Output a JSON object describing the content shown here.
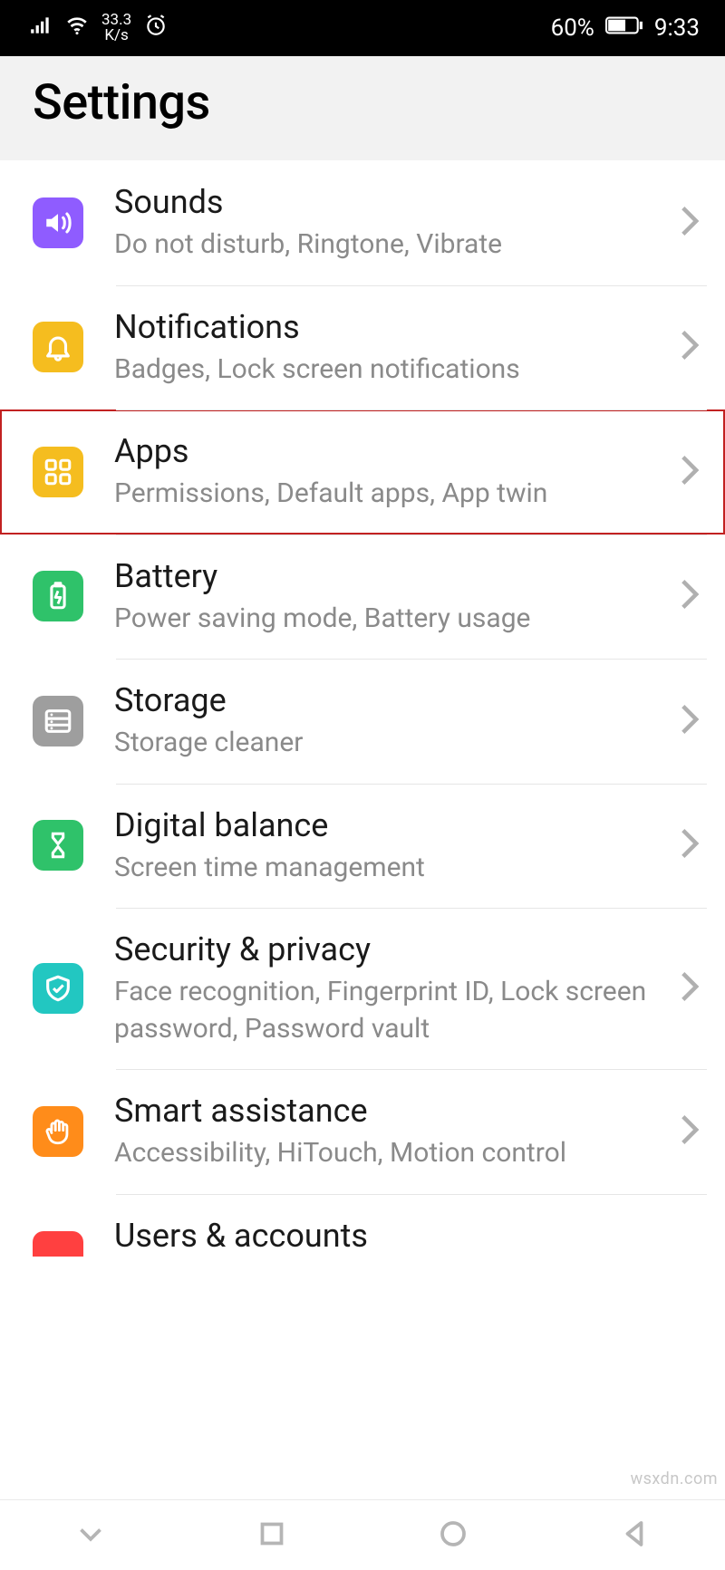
{
  "status_bar": {
    "net_speed_top": "33.3",
    "net_speed_bottom": "K/s",
    "battery_percent": "60%",
    "time": "9:33"
  },
  "header": {
    "title": "Settings"
  },
  "items": {
    "sounds": {
      "title": "Sounds",
      "subtitle": "Do not disturb, Ringtone, Vibrate",
      "color": "#8f5cff"
    },
    "notif": {
      "title": "Notifications",
      "subtitle": "Badges, Lock screen notifications",
      "color": "#f5bd1f"
    },
    "apps": {
      "title": "Apps",
      "subtitle": "Permissions, Default apps, App twin",
      "color": "#f5bd1f"
    },
    "battery": {
      "title": "Battery",
      "subtitle": "Power saving mode, Battery usage",
      "color": "#2fc26a"
    },
    "storage": {
      "title": "Storage",
      "subtitle": "Storage cleaner",
      "color": "#9e9e9e"
    },
    "digital": {
      "title": "Digital balance",
      "subtitle": "Screen time management",
      "color": "#2fc26a"
    },
    "security": {
      "title": "Security & privacy",
      "subtitle": "Face recognition, Fingerprint ID, Lock screen password, Password vault",
      "color": "#22c7c1"
    },
    "smart": {
      "title": "Smart assistance",
      "subtitle": "Accessibility, HiTouch, Motion control",
      "color": "#ff8c1a"
    },
    "users": {
      "title": "Users & accounts",
      "subtitle": "",
      "color": "#ff4040"
    }
  },
  "watermark": "wsxdn.com"
}
